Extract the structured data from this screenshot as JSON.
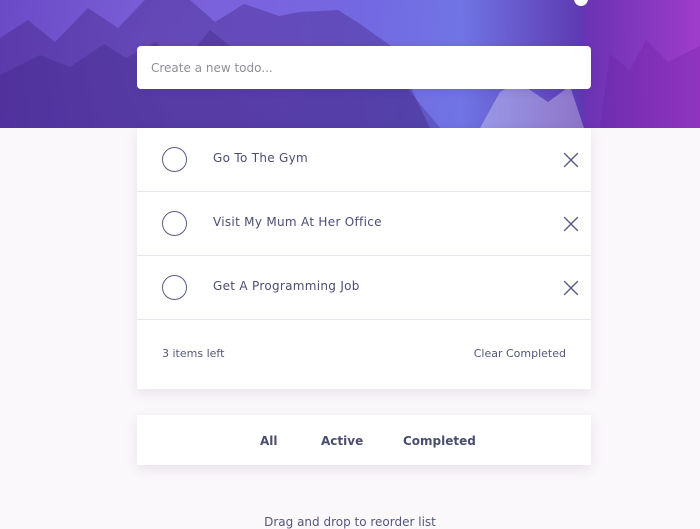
{
  "new_todo": {
    "placeholder": "Create a new todo..."
  },
  "todos": [
    {
      "label": "Go To The Gym",
      "completed": false
    },
    {
      "label": "Visit My Mum At Her Office",
      "completed": false
    },
    {
      "label": "Get A Programming Job",
      "completed": false
    }
  ],
  "footer": {
    "items_left": "3 items left",
    "clear_completed": "Clear Completed"
  },
  "filters": {
    "all": "All",
    "active": "Active",
    "completed": "Completed"
  },
  "hint": "Drag and drop to reorder list",
  "icons": {
    "todo_check": "circle-icon",
    "delete": "close-icon"
  },
  "colors": {
    "page_background": "#fbf8fb",
    "hero_start": "#6847c4",
    "hero_end": "#b146d6",
    "text": "#4b4d73"
  }
}
